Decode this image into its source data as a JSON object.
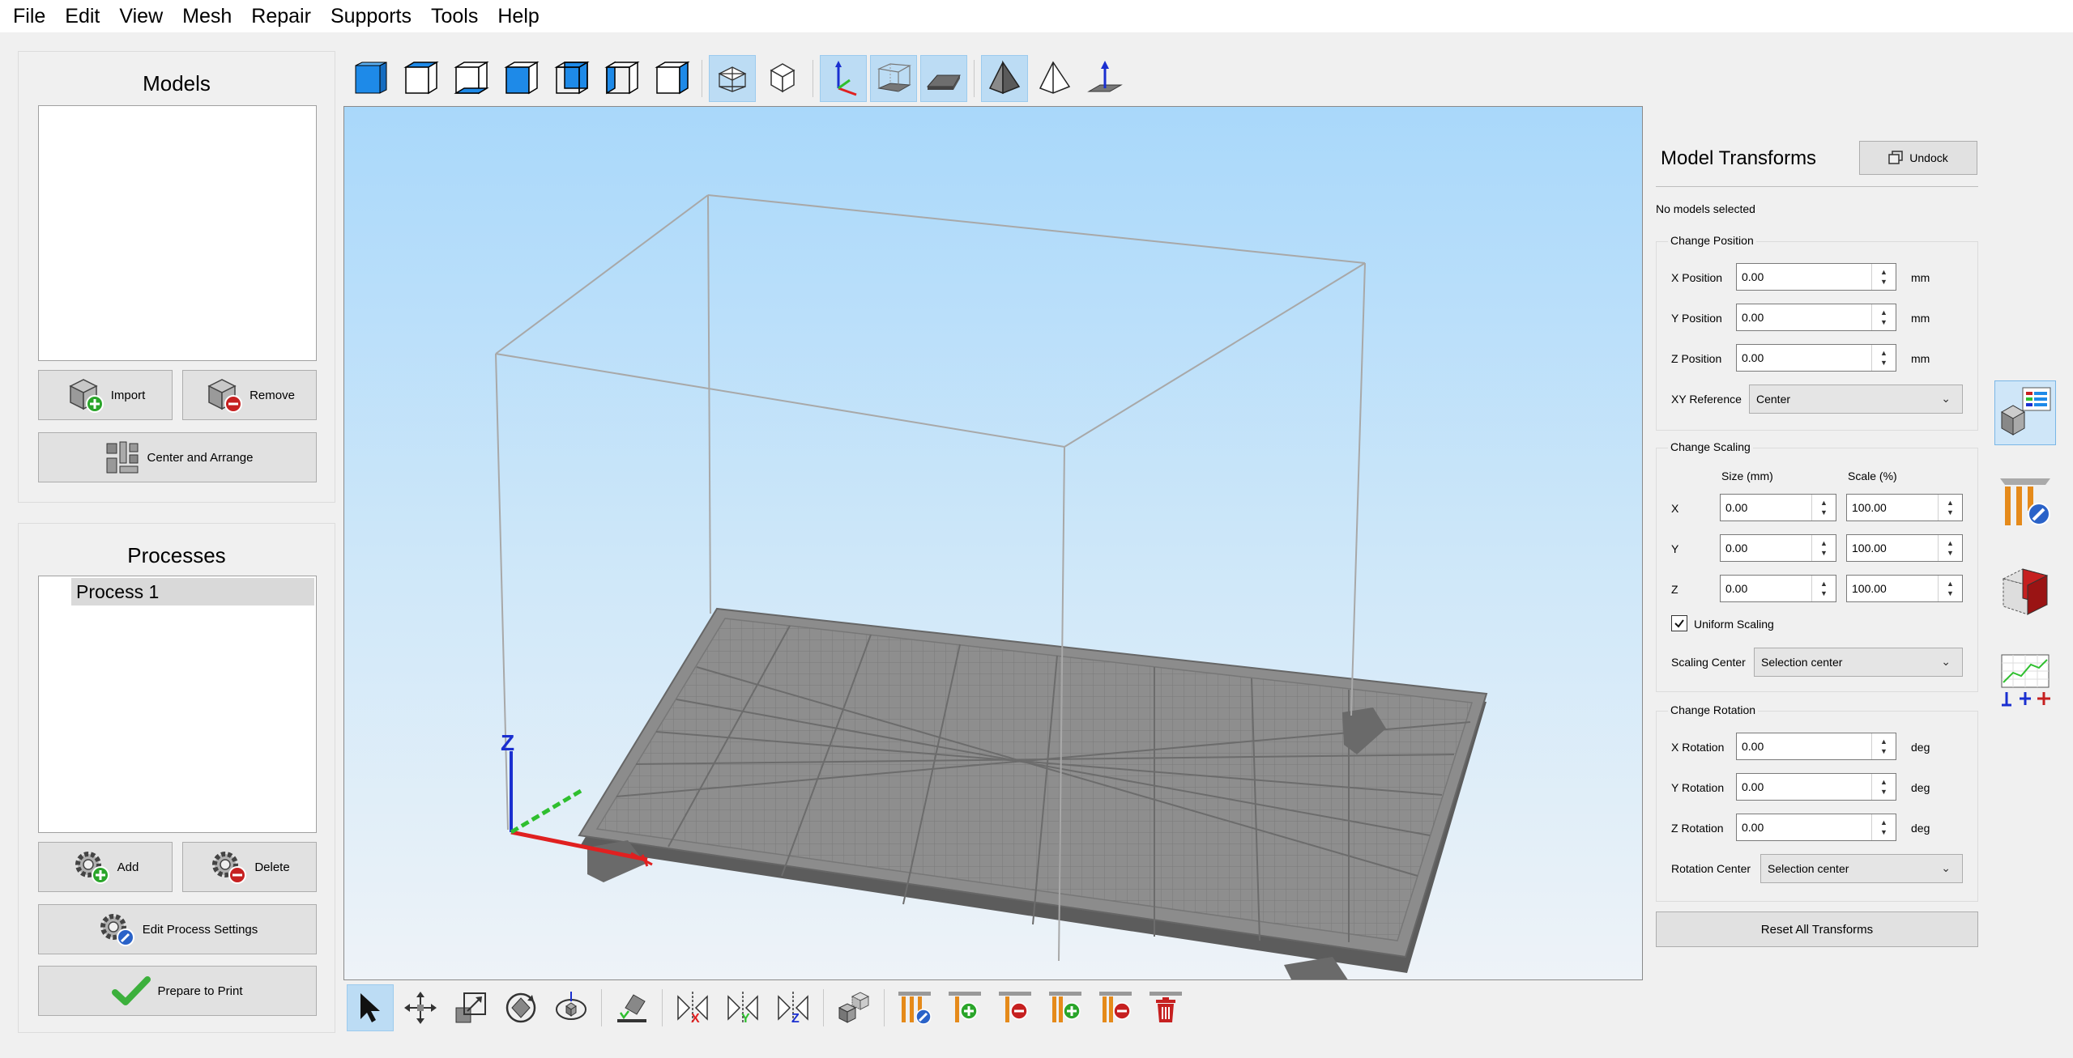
{
  "menu": [
    "File",
    "Edit",
    "View",
    "Mesh",
    "Repair",
    "Supports",
    "Tools",
    "Help"
  ],
  "models_panel": {
    "title": "Models",
    "import_label": "Import",
    "remove_label": "Remove",
    "center_arrange_label": "Center and Arrange"
  },
  "processes_panel": {
    "title": "Processes",
    "items": [
      "Process 1"
    ],
    "add_label": "Add",
    "delete_label": "Delete",
    "edit_settings_label": "Edit Process Settings",
    "prepare_label": "Prepare to Print"
  },
  "transforms": {
    "title": "Model Transforms",
    "undock_label": "Undock",
    "selection_status": "No models selected",
    "position": {
      "group_title": "Change Position",
      "x_label": "X Position",
      "x_value": "0.00",
      "y_label": "Y Position",
      "y_value": "0.00",
      "z_label": "Z Position",
      "z_value": "0.00",
      "unit": "mm",
      "xy_ref_label": "XY Reference",
      "xy_ref_value": "Center"
    },
    "scaling": {
      "group_title": "Change Scaling",
      "size_header": "Size (mm)",
      "scale_header": "Scale (%)",
      "x_label": "X",
      "x_size": "0.00",
      "x_scale": "100.00",
      "y_label": "Y",
      "y_size": "0.00",
      "y_scale": "100.00",
      "z_label": "Z",
      "z_size": "0.00",
      "z_scale": "100.00",
      "uniform_label": "Uniform Scaling",
      "uniform_checked": true,
      "center_label": "Scaling Center",
      "center_value": "Selection center"
    },
    "rotation": {
      "group_title": "Change Rotation",
      "x_label": "X Rotation",
      "x_value": "0.00",
      "y_label": "Y Rotation",
      "y_value": "0.00",
      "z_label": "Z Rotation",
      "z_value": "0.00",
      "unit": "deg",
      "center_label": "Rotation Center",
      "center_value": "Selection center"
    },
    "reset_label": "Reset All Transforms"
  },
  "axis_labels": {
    "z": "Z"
  },
  "colors": {
    "accent_blue": "#1e8ae8",
    "active_tool": "#bcdcf4",
    "axis_x": "#e02020",
    "axis_y": "#2fbf2f",
    "axis_z": "#1a2fd0",
    "support_orange": "#e58a1a"
  }
}
